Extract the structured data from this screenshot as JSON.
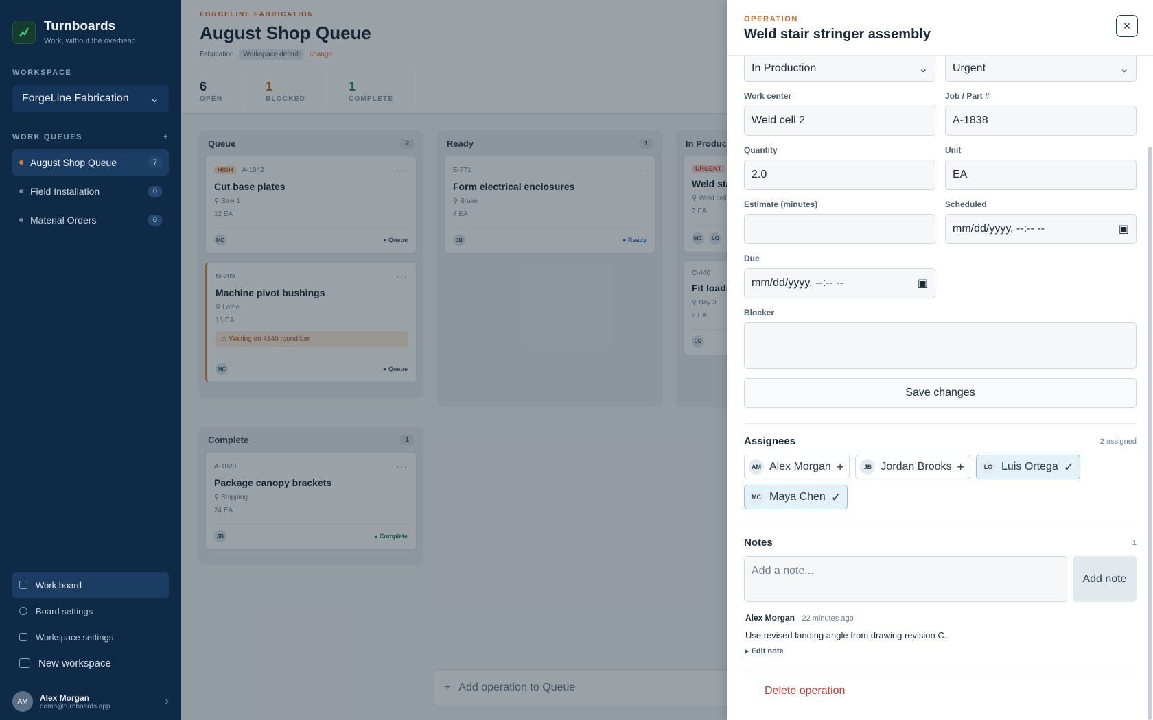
{
  "sidebar": {
    "brand_name": "Turnboards",
    "brand_tagline": "Work, without the overhead",
    "workspace_label": "WORKSPACE",
    "workspace_selected": "ForgeLine Fabrication",
    "queues_label": "WORK QUEUES",
    "queues": [
      {
        "label": "August Shop Queue",
        "count": "7"
      },
      {
        "label": "Field Installation",
        "count": "0"
      },
      {
        "label": "Material Orders",
        "count": "0"
      }
    ],
    "links": {
      "work_board": "Work board",
      "board_settings": "Board settings",
      "workspace_settings": "Workspace settings",
      "new_workspace": "New workspace"
    },
    "user": {
      "initials": "AM",
      "name": "Alex Morgan",
      "email": "demo@turnboards.app"
    }
  },
  "header": {
    "eyebrow": "FORGELINE FABRICATION",
    "title": "August Shop Queue",
    "meta_tag": "Fabrication",
    "meta_default": "Workspace default",
    "meta_change": "change"
  },
  "stats": [
    {
      "num": "6",
      "label": "OPEN"
    },
    {
      "num": "1",
      "label": "BLOCKED"
    },
    {
      "num": "1",
      "label": "COMPLETE"
    }
  ],
  "board": {
    "queue": {
      "title": "Queue",
      "count": "2",
      "cards": [
        {
          "priority": "HIGH",
          "id": "A-1842",
          "title": "Cut base plates",
          "loc": "Saw 1",
          "qty": "12 EA",
          "av": "MC",
          "stage": "● Queue"
        },
        {
          "id": "M-209",
          "title": "Machine pivot bushings",
          "loc": "Lathe",
          "qty": "16 EA",
          "blocker": "Waiting on 4140 round bar",
          "av": "MC",
          "stage": "● Queue"
        }
      ]
    },
    "ready": {
      "title": "Ready",
      "count": "1",
      "cards": [
        {
          "id": "E-771",
          "title": "Form electrical enclosures",
          "loc": "Brake",
          "qty": "4 EA",
          "av": "JB",
          "stage": "● Ready"
        }
      ]
    },
    "production": {
      "title": "In Production",
      "cards": [
        {
          "priority": "URGENT",
          "title": "Weld stai",
          "loc": "Weld cell",
          "qty": "2 EA",
          "av1": "MC",
          "av2": "LO"
        },
        {
          "id": "C-440",
          "title": "Fit loadin",
          "loc": "Bay 3",
          "qty": "8 EA",
          "av": "LO"
        }
      ]
    },
    "complete": {
      "title": "Complete",
      "count": "1",
      "cards": [
        {
          "id": "A-1820",
          "title": "Package canopy brackets",
          "loc": "Shipping",
          "qty": "24 EA",
          "av": "JB",
          "stage": "● Complete"
        }
      ]
    },
    "add_operation": "Add operation to Queue"
  },
  "drawer": {
    "eyebrow": "OPERATION",
    "title": "Weld stair stringer assembly",
    "status_value": "In Production",
    "priority_value": "Urgent",
    "work_center": {
      "label": "Work center",
      "value": "Weld cell 2"
    },
    "job": {
      "label": "Job / Part #",
      "value": "A-1838"
    },
    "quantity": {
      "label": "Quantity",
      "value": "2.0"
    },
    "unit": {
      "label": "Unit",
      "value": "EA"
    },
    "estimate": {
      "label": "Estimate (minutes)",
      "value": ""
    },
    "scheduled": {
      "label": "Scheduled",
      "value": "mm/dd/yyyy, --:-- --"
    },
    "due": {
      "label": "Due",
      "value": "mm/dd/yyyy, --:-- --"
    },
    "blocker": {
      "label": "Blocker",
      "value": ""
    },
    "save_label": "Save changes",
    "assignees": {
      "title": "Assignees",
      "meta": "2 assigned",
      "people": [
        {
          "initials": "AM",
          "name": "Alex Morgan",
          "assigned": false
        },
        {
          "initials": "JB",
          "name": "Jordan Brooks",
          "assigned": false
        },
        {
          "initials": "LO",
          "name": "Luis Ortega",
          "assigned": true
        },
        {
          "initials": "MC",
          "name": "Maya Chen",
          "assigned": true
        }
      ]
    },
    "notes": {
      "title": "Notes",
      "count": "1",
      "placeholder": "Add a note...",
      "add_label": "Add note",
      "entries": [
        {
          "author": "Alex Morgan",
          "time": "22 minutes ago",
          "text": "Use revised landing angle from drawing revision C.",
          "edit": "▸ Edit note"
        }
      ]
    },
    "delete_label": "Delete operation"
  },
  "colors": {
    "accent": "#d2652a",
    "sidebar": "#0f2a47",
    "danger": "#c73a2e",
    "assigned_chip": "#e4f1f7"
  }
}
